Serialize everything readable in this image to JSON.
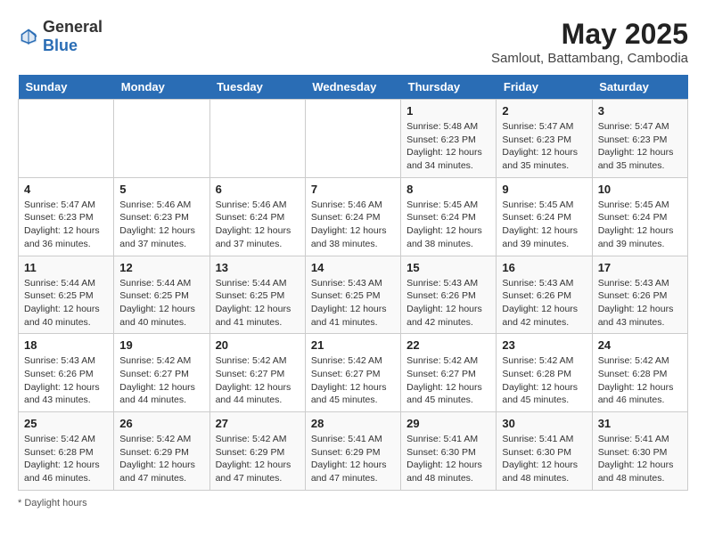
{
  "header": {
    "logo_general": "General",
    "logo_blue": "Blue",
    "month_year": "May 2025",
    "location": "Samlout, Battambang, Cambodia"
  },
  "days_of_week": [
    "Sunday",
    "Monday",
    "Tuesday",
    "Wednesday",
    "Thursday",
    "Friday",
    "Saturday"
  ],
  "weeks": [
    [
      {
        "day": "",
        "sunrise": "",
        "sunset": "",
        "daylight": ""
      },
      {
        "day": "",
        "sunrise": "",
        "sunset": "",
        "daylight": ""
      },
      {
        "day": "",
        "sunrise": "",
        "sunset": "",
        "daylight": ""
      },
      {
        "day": "",
        "sunrise": "",
        "sunset": "",
        "daylight": ""
      },
      {
        "day": "1",
        "sunrise": "Sunrise: 5:48 AM",
        "sunset": "Sunset: 6:23 PM",
        "daylight": "Daylight: 12 hours and 34 minutes."
      },
      {
        "day": "2",
        "sunrise": "Sunrise: 5:47 AM",
        "sunset": "Sunset: 6:23 PM",
        "daylight": "Daylight: 12 hours and 35 minutes."
      },
      {
        "day": "3",
        "sunrise": "Sunrise: 5:47 AM",
        "sunset": "Sunset: 6:23 PM",
        "daylight": "Daylight: 12 hours and 35 minutes."
      }
    ],
    [
      {
        "day": "4",
        "sunrise": "Sunrise: 5:47 AM",
        "sunset": "Sunset: 6:23 PM",
        "daylight": "Daylight: 12 hours and 36 minutes."
      },
      {
        "day": "5",
        "sunrise": "Sunrise: 5:46 AM",
        "sunset": "Sunset: 6:23 PM",
        "daylight": "Daylight: 12 hours and 37 minutes."
      },
      {
        "day": "6",
        "sunrise": "Sunrise: 5:46 AM",
        "sunset": "Sunset: 6:24 PM",
        "daylight": "Daylight: 12 hours and 37 minutes."
      },
      {
        "day": "7",
        "sunrise": "Sunrise: 5:46 AM",
        "sunset": "Sunset: 6:24 PM",
        "daylight": "Daylight: 12 hours and 38 minutes."
      },
      {
        "day": "8",
        "sunrise": "Sunrise: 5:45 AM",
        "sunset": "Sunset: 6:24 PM",
        "daylight": "Daylight: 12 hours and 38 minutes."
      },
      {
        "day": "9",
        "sunrise": "Sunrise: 5:45 AM",
        "sunset": "Sunset: 6:24 PM",
        "daylight": "Daylight: 12 hours and 39 minutes."
      },
      {
        "day": "10",
        "sunrise": "Sunrise: 5:45 AM",
        "sunset": "Sunset: 6:24 PM",
        "daylight": "Daylight: 12 hours and 39 minutes."
      }
    ],
    [
      {
        "day": "11",
        "sunrise": "Sunrise: 5:44 AM",
        "sunset": "Sunset: 6:25 PM",
        "daylight": "Daylight: 12 hours and 40 minutes."
      },
      {
        "day": "12",
        "sunrise": "Sunrise: 5:44 AM",
        "sunset": "Sunset: 6:25 PM",
        "daylight": "Daylight: 12 hours and 40 minutes."
      },
      {
        "day": "13",
        "sunrise": "Sunrise: 5:44 AM",
        "sunset": "Sunset: 6:25 PM",
        "daylight": "Daylight: 12 hours and 41 minutes."
      },
      {
        "day": "14",
        "sunrise": "Sunrise: 5:43 AM",
        "sunset": "Sunset: 6:25 PM",
        "daylight": "Daylight: 12 hours and 41 minutes."
      },
      {
        "day": "15",
        "sunrise": "Sunrise: 5:43 AM",
        "sunset": "Sunset: 6:26 PM",
        "daylight": "Daylight: 12 hours and 42 minutes."
      },
      {
        "day": "16",
        "sunrise": "Sunrise: 5:43 AM",
        "sunset": "Sunset: 6:26 PM",
        "daylight": "Daylight: 12 hours and 42 minutes."
      },
      {
        "day": "17",
        "sunrise": "Sunrise: 5:43 AM",
        "sunset": "Sunset: 6:26 PM",
        "daylight": "Daylight: 12 hours and 43 minutes."
      }
    ],
    [
      {
        "day": "18",
        "sunrise": "Sunrise: 5:43 AM",
        "sunset": "Sunset: 6:26 PM",
        "daylight": "Daylight: 12 hours and 43 minutes."
      },
      {
        "day": "19",
        "sunrise": "Sunrise: 5:42 AM",
        "sunset": "Sunset: 6:27 PM",
        "daylight": "Daylight: 12 hours and 44 minutes."
      },
      {
        "day": "20",
        "sunrise": "Sunrise: 5:42 AM",
        "sunset": "Sunset: 6:27 PM",
        "daylight": "Daylight: 12 hours and 44 minutes."
      },
      {
        "day": "21",
        "sunrise": "Sunrise: 5:42 AM",
        "sunset": "Sunset: 6:27 PM",
        "daylight": "Daylight: 12 hours and 45 minutes."
      },
      {
        "day": "22",
        "sunrise": "Sunrise: 5:42 AM",
        "sunset": "Sunset: 6:27 PM",
        "daylight": "Daylight: 12 hours and 45 minutes."
      },
      {
        "day": "23",
        "sunrise": "Sunrise: 5:42 AM",
        "sunset": "Sunset: 6:28 PM",
        "daylight": "Daylight: 12 hours and 45 minutes."
      },
      {
        "day": "24",
        "sunrise": "Sunrise: 5:42 AM",
        "sunset": "Sunset: 6:28 PM",
        "daylight": "Daylight: 12 hours and 46 minutes."
      }
    ],
    [
      {
        "day": "25",
        "sunrise": "Sunrise: 5:42 AM",
        "sunset": "Sunset: 6:28 PM",
        "daylight": "Daylight: 12 hours and 46 minutes."
      },
      {
        "day": "26",
        "sunrise": "Sunrise: 5:42 AM",
        "sunset": "Sunset: 6:29 PM",
        "daylight": "Daylight: 12 hours and 47 minutes."
      },
      {
        "day": "27",
        "sunrise": "Sunrise: 5:42 AM",
        "sunset": "Sunset: 6:29 PM",
        "daylight": "Daylight: 12 hours and 47 minutes."
      },
      {
        "day": "28",
        "sunrise": "Sunrise: 5:41 AM",
        "sunset": "Sunset: 6:29 PM",
        "daylight": "Daylight: 12 hours and 47 minutes."
      },
      {
        "day": "29",
        "sunrise": "Sunrise: 5:41 AM",
        "sunset": "Sunset: 6:30 PM",
        "daylight": "Daylight: 12 hours and 48 minutes."
      },
      {
        "day": "30",
        "sunrise": "Sunrise: 5:41 AM",
        "sunset": "Sunset: 6:30 PM",
        "daylight": "Daylight: 12 hours and 48 minutes."
      },
      {
        "day": "31",
        "sunrise": "Sunrise: 5:41 AM",
        "sunset": "Sunset: 6:30 PM",
        "daylight": "Daylight: 12 hours and 48 minutes."
      }
    ]
  ],
  "footer": "Daylight hours"
}
